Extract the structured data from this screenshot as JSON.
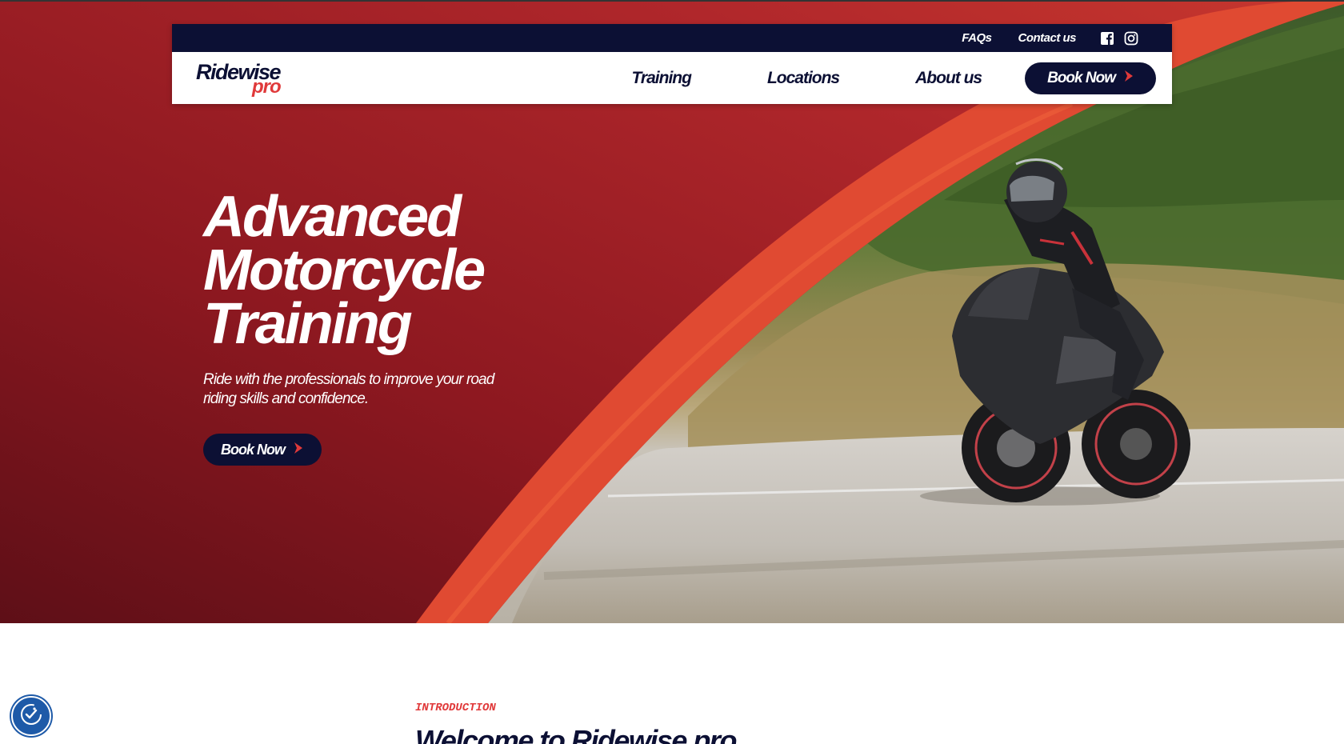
{
  "colors": {
    "brand_navy": "#0c1034",
    "brand_red": "#e0393a",
    "hero_red_dark": "#6a1119",
    "hero_red": "#a0232a",
    "accent_orange_red": "#e04a32"
  },
  "header": {
    "utility": {
      "faqs": "FAQs",
      "contact": "Contact us",
      "social_icons": [
        "facebook-icon",
        "instagram-icon"
      ]
    },
    "logo": {
      "word": "Ridewise",
      "suffix": "pro"
    },
    "nav": {
      "training": "Training",
      "locations": "Locations",
      "about": "About us",
      "book": "Book Now"
    }
  },
  "hero": {
    "title_line1": "Advanced",
    "title_line2": "Motorcycle",
    "title_line3": "Training",
    "subtitle": "Ride with the professionals to improve your road riding skills and confidence.",
    "cta": "Book Now"
  },
  "intro": {
    "eyebrow": "INTRODUCTION",
    "heading": "Welcome to Ridewise pro"
  },
  "accessibility": {
    "icon": "accessibility-icon"
  }
}
